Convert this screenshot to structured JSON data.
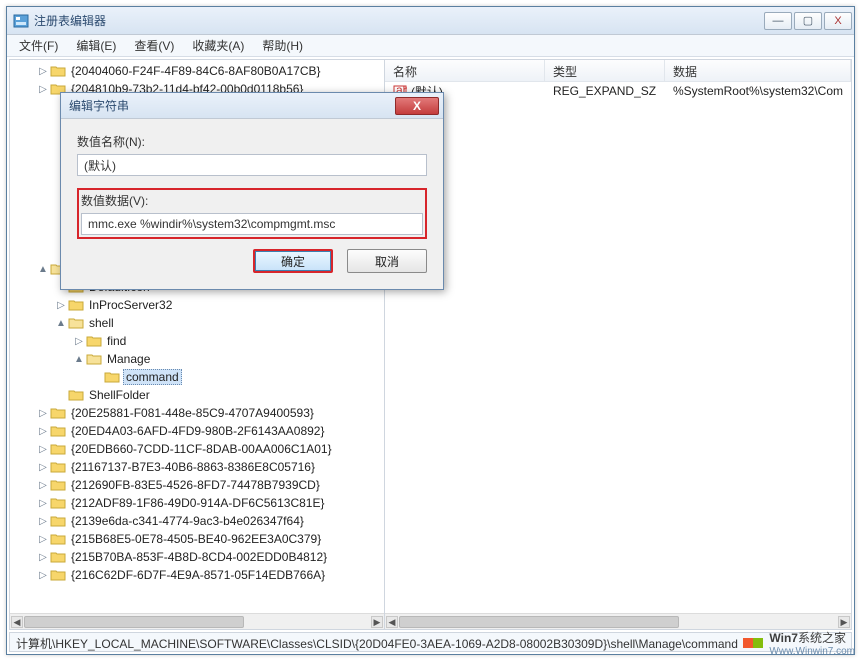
{
  "window": {
    "title": "注册表编辑器"
  },
  "winbtns": {
    "min": "—",
    "max": "▢",
    "close": "X"
  },
  "menubar": [
    "文件(F)",
    "编辑(E)",
    "查看(V)",
    "收藏夹(A)",
    "帮助(H)"
  ],
  "tree": [
    {
      "depth": 1,
      "exp": "▷",
      "label": "{20404060-F24F-4F89-84C6-8AF80B0A17CB}"
    },
    {
      "depth": 1,
      "exp": "▷",
      "label": "{204810b9-73b2-11d4-bf42-00b0d0118b56}"
    },
    {
      "depth": 1,
      "exp": "",
      "label": ""
    },
    {
      "depth": 1,
      "exp": "",
      "label": ""
    },
    {
      "depth": 1,
      "exp": "",
      "label": ""
    },
    {
      "depth": 1,
      "exp": "",
      "label": ""
    },
    {
      "depth": 1,
      "exp": "",
      "label": ""
    },
    {
      "depth": 1,
      "exp": "",
      "label": ""
    },
    {
      "depth": 1,
      "exp": "",
      "label": ""
    },
    {
      "depth": 1,
      "exp": "",
      "label": ""
    },
    {
      "depth": 1,
      "exp": "",
      "label": ""
    },
    {
      "depth": 1,
      "exp": "▲",
      "label": "{20D04FE0-3AEA-1069-A2D8-08002B30309D}",
      "open": true
    },
    {
      "depth": 2,
      "exp": "",
      "label": "DefaultIcon"
    },
    {
      "depth": 2,
      "exp": "▷",
      "label": "InProcServer32"
    },
    {
      "depth": 2,
      "exp": "▲",
      "label": "shell",
      "open": true
    },
    {
      "depth": 3,
      "exp": "▷",
      "label": "find"
    },
    {
      "depth": 3,
      "exp": "▲",
      "label": "Manage",
      "open": true
    },
    {
      "depth": 4,
      "exp": "",
      "label": "command",
      "selected": true
    },
    {
      "depth": 2,
      "exp": "",
      "label": "ShellFolder"
    },
    {
      "depth": 1,
      "exp": "▷",
      "label": "{20E25881-F081-448e-85C9-4707A9400593}"
    },
    {
      "depth": 1,
      "exp": "▷",
      "label": "{20ED4A03-6AFD-4FD9-980B-2F6143AA0892}"
    },
    {
      "depth": 1,
      "exp": "▷",
      "label": "{20EDB660-7CDD-11CF-8DAB-00AA006C1A01}"
    },
    {
      "depth": 1,
      "exp": "▷",
      "label": "{21167137-B7E3-40B6-8863-8386E8C05716}"
    },
    {
      "depth": 1,
      "exp": "▷",
      "label": "{212690FB-83E5-4526-8FD7-74478B7939CD}"
    },
    {
      "depth": 1,
      "exp": "▷",
      "label": "{212ADF89-1F86-49D0-914A-DF6C5613C81E}"
    },
    {
      "depth": 1,
      "exp": "▷",
      "label": "{2139e6da-c341-4774-9ac3-b4e026347f64}"
    },
    {
      "depth": 1,
      "exp": "▷",
      "label": "{215B68E5-0E78-4505-BE40-962EE3A0C379}"
    },
    {
      "depth": 1,
      "exp": "▷",
      "label": "{215B70BA-853F-4B8D-8CD4-002EDD0B4812}"
    },
    {
      "depth": 1,
      "exp": "▷",
      "label": "{216C62DF-6D7F-4E9A-8571-05F14EDB766A}"
    }
  ],
  "listhdr": {
    "name": "名称",
    "type": "类型",
    "data": "数据"
  },
  "listrow": {
    "name": "(默认)",
    "type": "REG_EXPAND_SZ",
    "data": "%SystemRoot%\\system32\\Com"
  },
  "status": "计算机\\HKEY_LOCAL_MACHINE\\SOFTWARE\\Classes\\CLSID\\{20D04FE0-3AEA-1069-A2D8-08002B30309D}\\shell\\Manage\\command",
  "dialog": {
    "title": "编辑字符串",
    "name_label": "数值名称(N):",
    "name_value": "(默认)",
    "data_label": "数值数据(V):",
    "data_value": "mmc.exe %windir%\\system32\\compmgmt.msc",
    "ok": "确定",
    "cancel": "取消"
  },
  "watermark": {
    "brand": "Win7",
    "brand2": "系统之家",
    "url": "Www.Winwin7.com"
  }
}
